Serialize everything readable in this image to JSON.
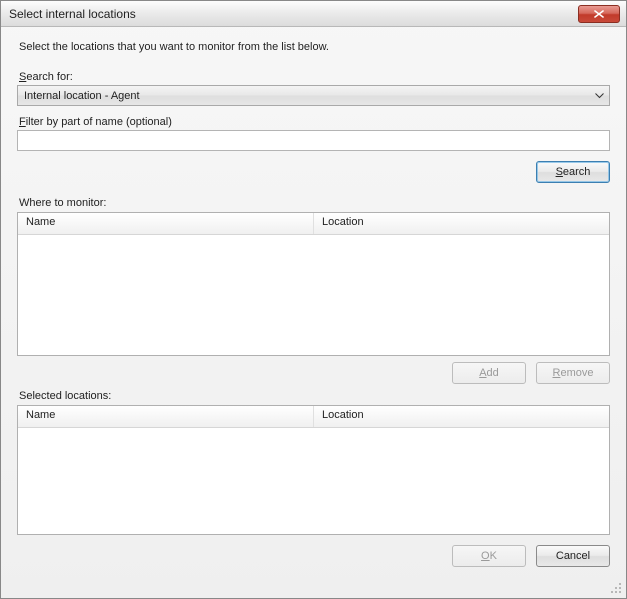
{
  "window": {
    "title": "Select internal locations",
    "instruction": "Select the locations that you want to monitor from the list below."
  },
  "search": {
    "label_prefix": "S",
    "label_rest": "earch for:",
    "combo_value": "Internal location - Agent",
    "filter_label_prefix": "F",
    "filter_label_rest": "ilter by part of name (optional)",
    "filter_value": "",
    "search_btn_prefix": "S",
    "search_btn_rest": "earch"
  },
  "where": {
    "label": "Where to monitor:",
    "col_name": "Name",
    "col_location": "Location"
  },
  "actions": {
    "add_prefix": "A",
    "add_rest": "dd",
    "remove_prefix": "R",
    "remove_rest": "emove"
  },
  "selected": {
    "label": "Selected locations:",
    "col_name": "Name",
    "col_location": "Location"
  },
  "footer": {
    "ok_prefix": "O",
    "ok_rest": "K",
    "cancel": "Cancel"
  }
}
